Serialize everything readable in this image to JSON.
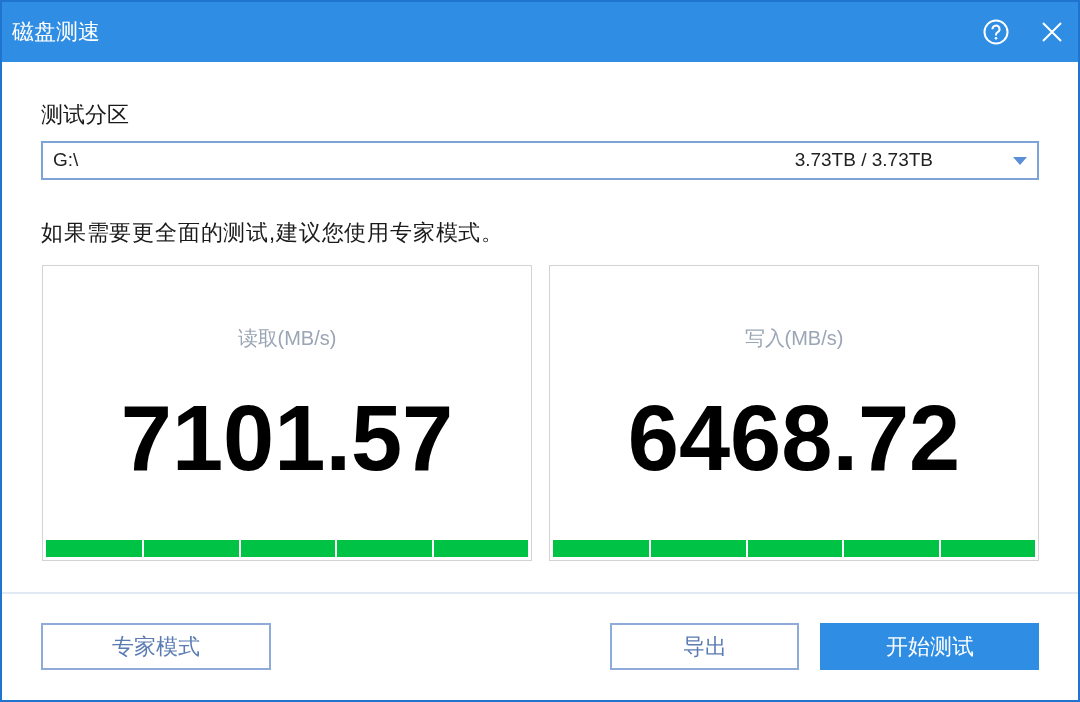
{
  "window": {
    "title": "磁盘测速"
  },
  "partition": {
    "label": "测试分区",
    "value": "G:\\",
    "capacity": "3.73TB / 3.73TB"
  },
  "hint": "如果需要更全面的测试,建议您使用专家模式。",
  "results": [
    {
      "label": "读取(MB/s)",
      "value": "7101.57",
      "level": 1
    },
    {
      "label": "写入(MB/s)",
      "value": "6468.72",
      "level": 1
    }
  ],
  "buttons": [
    {
      "label": "专家模式",
      "kind": "outline"
    },
    {
      "label": "导出",
      "kind": "outline"
    },
    {
      "label": "开始测试",
      "kind": "primary"
    }
  ]
}
